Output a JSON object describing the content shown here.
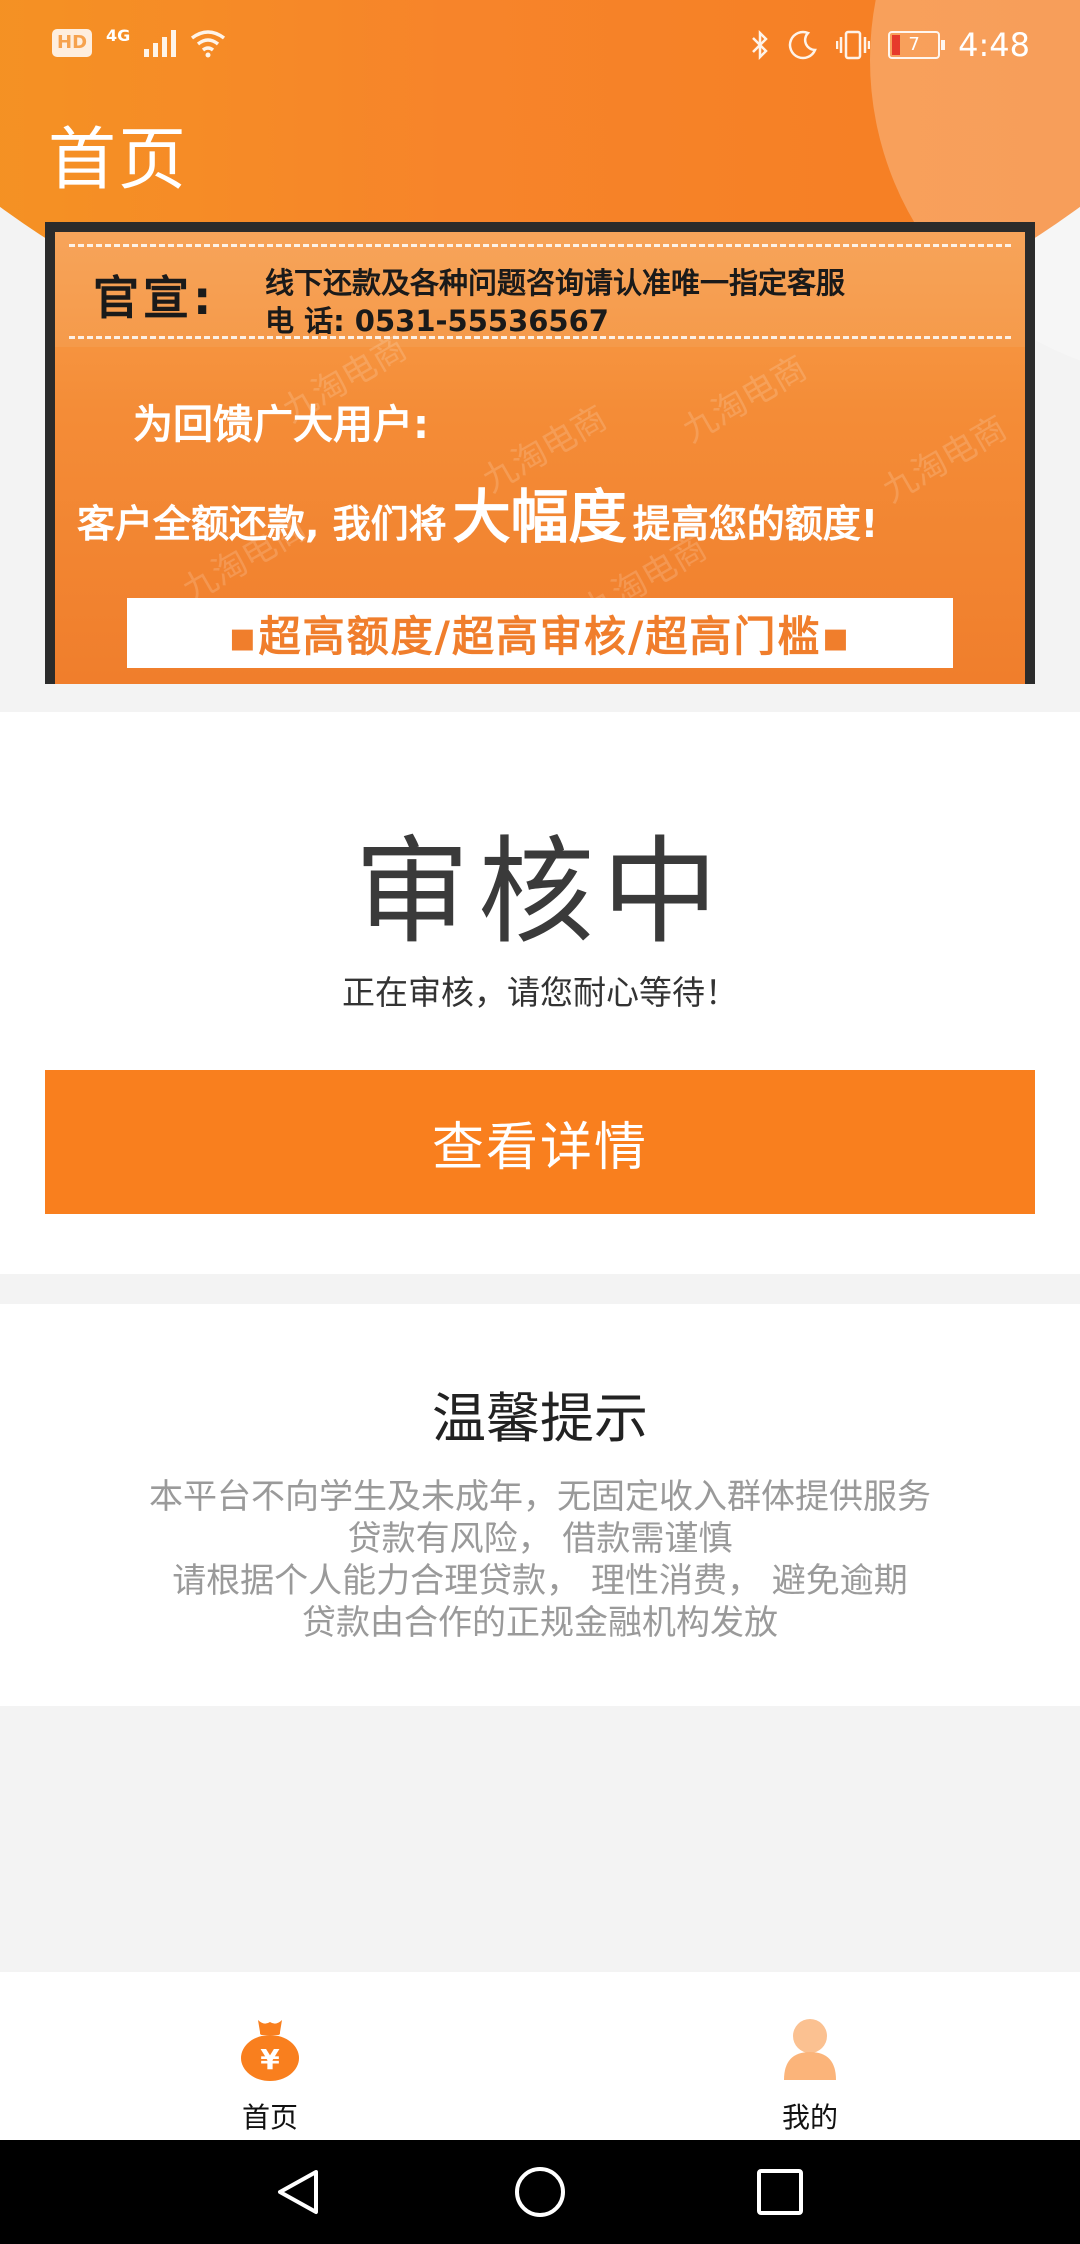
{
  "status_bar": {
    "left_icons": [
      "hd-icon",
      "4g-signal-icon",
      "wifi-icon"
    ],
    "hd_text": "HD",
    "network_text": "4G",
    "right_icons": [
      "bluetooth-icon",
      "moon-icon",
      "vibrate-icon",
      "battery-icon"
    ],
    "battery_level": "7",
    "time": "4:48"
  },
  "header": {
    "title": "首页"
  },
  "banner": {
    "official_label": "官宣:",
    "line1": "线下还款及各种问题咨询请认准唯一指定客服",
    "line2": "电 话: 0531-55536567",
    "feedback": "为回馈广大用户:",
    "promise_pre": "客户全额还款, 我们将",
    "promise_big": "大幅度",
    "promise_post": "提高您的额度!",
    "bar_text": "▪超高额度/超高审核/超高门槛▪",
    "watermark": "九淘电商"
  },
  "status": {
    "title": "审核中",
    "description": "正在审核，请您耐心等待！",
    "button_label": "查看详情"
  },
  "tips": {
    "title": "温馨提示",
    "lines": [
      "本平台不向学生及未成年，无固定收入群体提供服务",
      "贷款有风险，  借款需谨慎",
      "请根据个人能力合理贷款，  理性消费，  避免逾期",
      "贷款由合作的正规金融机构发放"
    ]
  },
  "tabbar": {
    "items": [
      {
        "label": "首页",
        "icon": "money-bag-icon",
        "active": true
      },
      {
        "label": "我的",
        "icon": "person-icon",
        "active": false
      }
    ]
  },
  "colors": {
    "accent": "#f97f1e",
    "header_gradient_start": "#f39a1f",
    "header_gradient_end": "#f47b1f",
    "tip_text": "#9a9a9a"
  }
}
